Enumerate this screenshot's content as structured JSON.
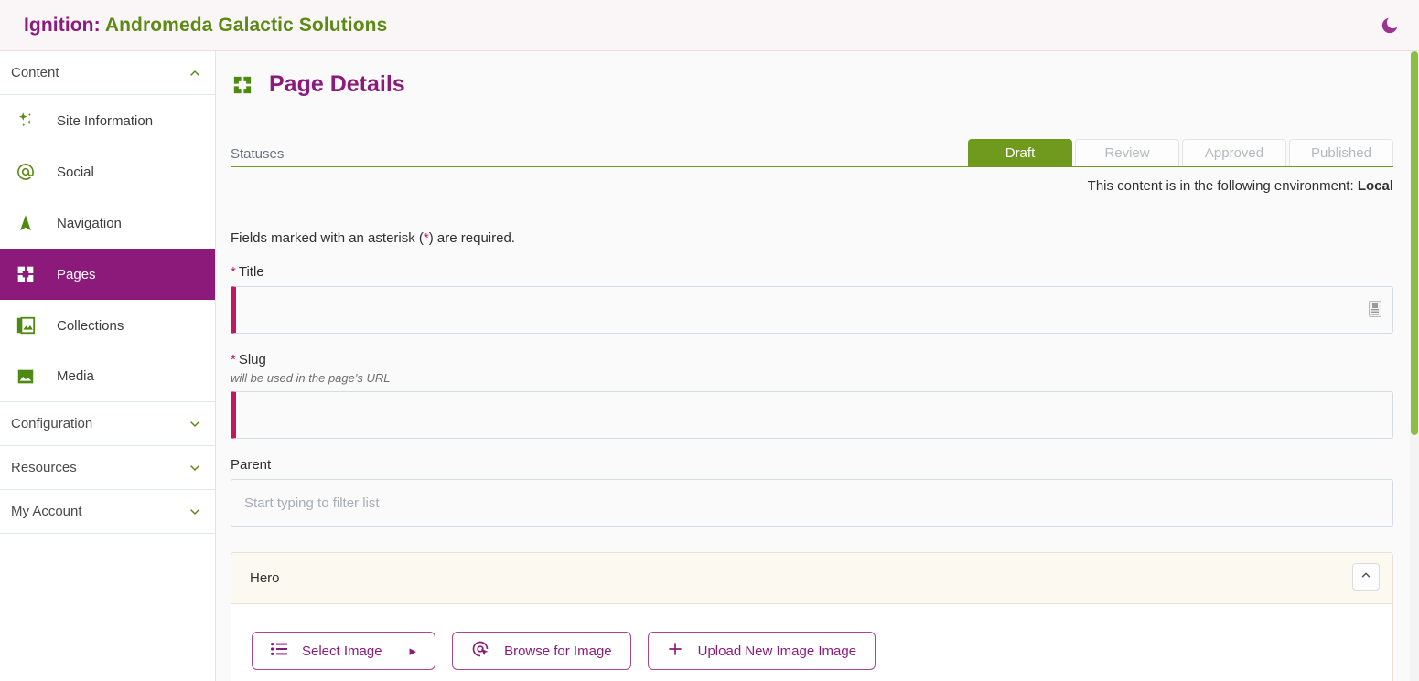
{
  "topbar": {
    "app_name": "Ignition:",
    "site_name": "Andromeda Galactic Solutions",
    "theme_toggle_icon": "moon-icon"
  },
  "sidebar": {
    "groups": [
      {
        "label": "Content",
        "icon": "chevron-up-icon",
        "expanded": true
      },
      {
        "label": "Configuration",
        "icon": "chevron-down-icon",
        "expanded": false
      },
      {
        "label": "Resources",
        "icon": "chevron-down-icon",
        "expanded": false
      },
      {
        "label": "My Account",
        "icon": "chevron-down-icon",
        "expanded": false
      }
    ],
    "items": [
      {
        "label": "Site Information",
        "icon": "sparkles-icon",
        "active": false
      },
      {
        "label": "Social",
        "icon": "at-sign-icon",
        "active": false
      },
      {
        "label": "Navigation",
        "icon": "navigation-arrow-icon",
        "active": false
      },
      {
        "label": "Pages",
        "icon": "pages-icon",
        "active": true
      },
      {
        "label": "Collections",
        "icon": "collections-images-icon",
        "active": false
      },
      {
        "label": "Media",
        "icon": "media-image-icon",
        "active": false
      }
    ]
  },
  "main": {
    "page_title": "Page Details",
    "page_title_icon": "pages-icon",
    "statuses_label": "Statuses",
    "status_tabs": [
      {
        "label": "Draft",
        "active": true
      },
      {
        "label": "Review",
        "active": false
      },
      {
        "label": "Approved",
        "active": false
      },
      {
        "label": "Published",
        "active": false
      }
    ],
    "environment_note_prefix": "This content is in the following environment:",
    "environment_name": "Local",
    "required_note_before": "Fields marked with an asterisk (",
    "required_note_asterisk": "*",
    "required_note_after": ") are required.",
    "fields": {
      "title": {
        "label": "Title",
        "asterisk": "*",
        "value": "",
        "placeholder": "",
        "affix_icon": "text-entry-icon"
      },
      "slug": {
        "label": "Slug",
        "asterisk": "*",
        "hint": "will be used in the page's URL",
        "value": "",
        "placeholder": ""
      },
      "parent": {
        "label": "Parent",
        "value": "",
        "placeholder": "Start typing to filter list"
      }
    },
    "hero_panel": {
      "title": "Hero",
      "collapse_icon": "chevron-up-icon",
      "buttons": [
        {
          "label": "Select Image",
          "icon": "list-icon",
          "caret": "▸"
        },
        {
          "label": "Browse for Image",
          "icon": "target-cursor-icon",
          "caret": ""
        },
        {
          "label": "Upload New Image Image",
          "icon": "plus-icon",
          "caret": ""
        }
      ]
    }
  },
  "colors": {
    "brand_purple": "#8b1a7a",
    "brand_green": "#5c8a14",
    "status_active_green": "#6f9a1e",
    "required_crimson": "#c0175e",
    "scrollbar_green": "#8bbf44"
  }
}
